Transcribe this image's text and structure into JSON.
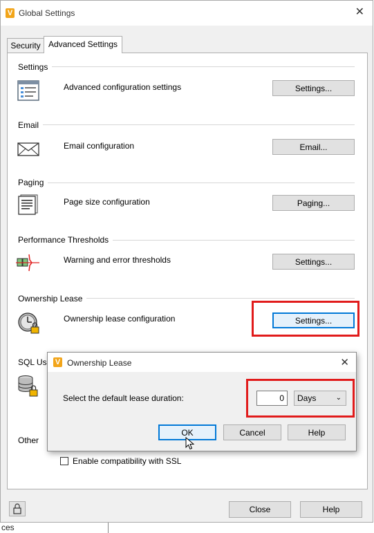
{
  "window": {
    "title": "Global Settings"
  },
  "tabs": [
    {
      "label": "Security"
    },
    {
      "label": "Advanced Settings"
    }
  ],
  "sections": {
    "settings": {
      "title": "Settings",
      "row_label": "Advanced configuration settings",
      "button": "Settings..."
    },
    "email": {
      "title": "Email",
      "row_label": "Email configuration",
      "button": "Email..."
    },
    "paging": {
      "title": "Paging",
      "row_label": "Page size configuration",
      "button": "Paging..."
    },
    "performance": {
      "title": "Performance Thresholds",
      "row_label": "Warning and error thresholds",
      "button": "Settings..."
    },
    "ownership": {
      "title": "Ownership Lease",
      "row_label": "Ownership lease configuration",
      "button": "Settings..."
    },
    "sql": {
      "title": "SQL Use"
    },
    "other": {
      "title": "Other",
      "checkbox_label": "Enable compatibility with SSL",
      "checked": false
    }
  },
  "dialog": {
    "title": "Ownership Lease",
    "prompt": "Select the default lease duration:",
    "duration_value": "0",
    "duration_unit": "Days",
    "buttons": {
      "ok": "OK",
      "cancel": "Cancel",
      "help": "Help"
    }
  },
  "footer": {
    "close": "Close",
    "help": "Help"
  },
  "behind_text": "ces",
  "colors": {
    "highlight_red": "#e11b1b",
    "focus_blue": "#0078d7",
    "logo_orange": "#f2a51a"
  }
}
